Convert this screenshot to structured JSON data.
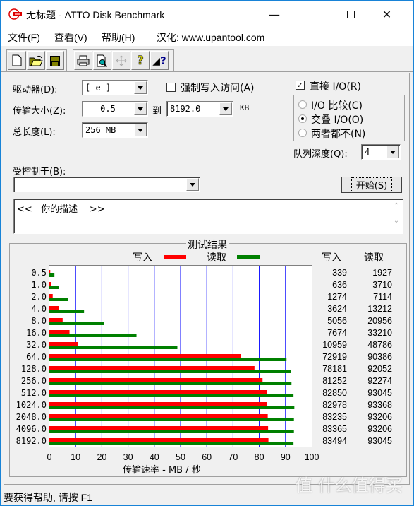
{
  "window": {
    "title": "无标题 - ATTO Disk Benchmark",
    "controls": [
      "minimize",
      "maximize",
      "close"
    ]
  },
  "menu": {
    "items": [
      "文件(F)",
      "查看(V)",
      "帮助(H)"
    ],
    "credit": "汉化: www.upantool.com"
  },
  "toolbar": {
    "buttons": [
      "new-icon",
      "open-icon",
      "save-icon",
      "print-icon",
      "print-preview-icon",
      "move-icon",
      "help-icon",
      "context-help-icon"
    ]
  },
  "settings": {
    "drive_label": "驱动器(D):",
    "drive_value": "[-e-]",
    "force_write_label": "强制写入访问(A)",
    "force_write_checked": false,
    "transfer_size_label": "传输大小(Z):",
    "transfer_from": "0.5",
    "to_label": "到",
    "transfer_to": "8192.0",
    "unit_label": "KB",
    "total_length_label": "总长度(L):",
    "total_length_value": "256 MB",
    "direct_io_label": "直接 I/O(R)",
    "direct_io_checked": true,
    "io_modes": [
      {
        "label": "I/O 比较(C)",
        "selected": false
      },
      {
        "label": "交叠 I/O(O)",
        "selected": true
      },
      {
        "label": "两者都不(N)",
        "selected": false
      }
    ],
    "queue_depth_label": "队列深度(Q):",
    "queue_depth_value": "4",
    "controlled_by_label": "受控制于(B):",
    "controlled_by_value": "",
    "start_button": "开始(S)",
    "description": "<<   你的描述    >>"
  },
  "results": {
    "title": "测试结果",
    "write_header": "写入",
    "read_header": "读取"
  },
  "chart_data": {
    "type": "bar",
    "orientation": "horizontal",
    "title": "测试结果",
    "xlabel": "传输速率 - MB / 秒",
    "ylabel": "",
    "xlim": [
      0,
      100
    ],
    "xticks": [
      0,
      10,
      20,
      30,
      40,
      50,
      60,
      70,
      80,
      90,
      100
    ],
    "grid": true,
    "legend": "top",
    "colors": {
      "write": "#ff0000",
      "read": "#008000",
      "grid": "#0000ff"
    },
    "categories": [
      "0.5",
      "1.0",
      "2.0",
      "4.0",
      "8.0",
      "16.0",
      "32.0",
      "64.0",
      "128.0",
      "256.0",
      "512.0",
      "1024.0",
      "2048.0",
      "4096.0",
      "8192.0"
    ],
    "series": [
      {
        "name": "写入",
        "unit": "KB/s",
        "values": [
          339,
          636,
          1274,
          3624,
          5056,
          7674,
          10959,
          72919,
          78181,
          81252,
          82850,
          82978,
          83235,
          83365,
          83494
        ]
      },
      {
        "name": "读取",
        "unit": "KB/s",
        "values": [
          1927,
          3710,
          7114,
          13212,
          20956,
          33210,
          48786,
          90386,
          92052,
          92274,
          93045,
          93368,
          93206,
          93206,
          93045
        ]
      }
    ]
  },
  "status": {
    "text": "要获得帮助, 请按 F1"
  },
  "watermark": "值 什么值得买"
}
